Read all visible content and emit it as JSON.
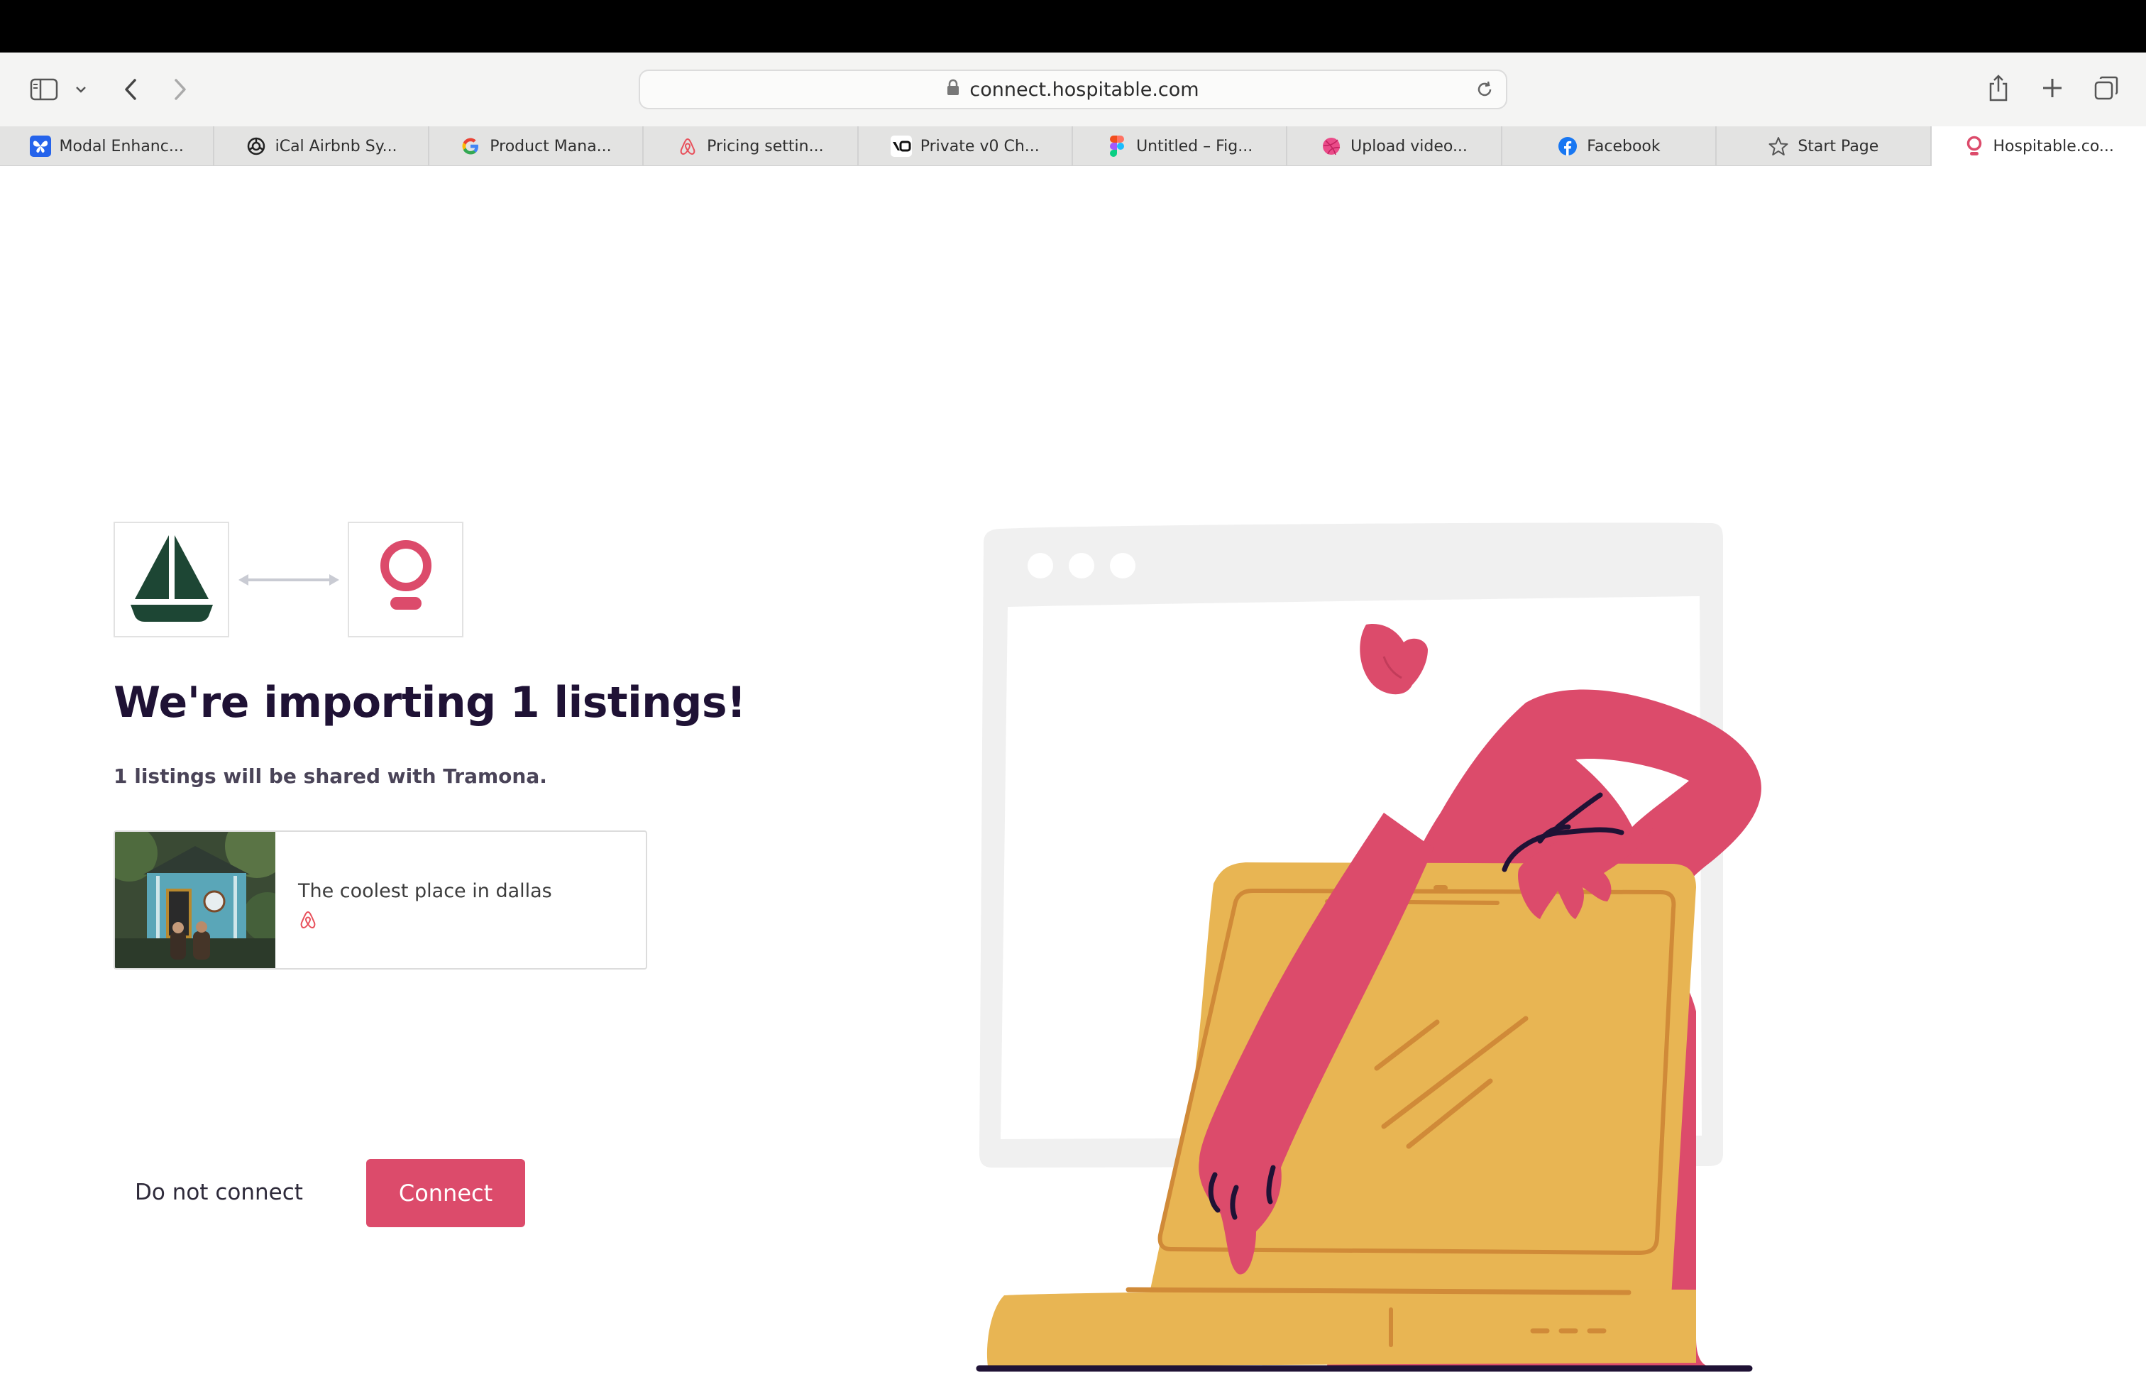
{
  "browser": {
    "url": "connect.hospitable.com",
    "tabs": [
      {
        "label": "Modal Enhanc...",
        "icon": "butterfly-icon",
        "active": false
      },
      {
        "label": "iCal Airbnb Sy...",
        "icon": "openai-icon",
        "active": false
      },
      {
        "label": "Product Mana...",
        "icon": "google-icon",
        "active": false
      },
      {
        "label": "Pricing settin...",
        "icon": "airbnb-icon",
        "active": false
      },
      {
        "label": "Private v0 Ch...",
        "icon": "v0-icon",
        "active": false
      },
      {
        "label": "Untitled – Fig...",
        "icon": "figma-icon",
        "active": false
      },
      {
        "label": "Upload video...",
        "icon": "dribbble-icon",
        "active": false
      },
      {
        "label": "Facebook",
        "icon": "facebook-icon",
        "active": false
      },
      {
        "label": "Start Page",
        "icon": "star-icon",
        "active": false
      },
      {
        "label": "Hospitable.co...",
        "icon": "hospitable-icon",
        "active": true
      }
    ]
  },
  "page": {
    "heading": "We're importing 1 listings!",
    "subtext": "1 listings will be shared with Tramona.",
    "listing": {
      "name": "The coolest place in dallas",
      "platform_icon": "airbnb-icon"
    },
    "buttons": {
      "secondary": "Do not connect",
      "primary": "Connect"
    }
  },
  "colors": {
    "brand": "#dc4b6b",
    "heading": "#1f1235",
    "tramona_logo": "#1d4634",
    "illustration_tablet": "#e8b553",
    "illustration_figure": "#dc4b6b"
  }
}
